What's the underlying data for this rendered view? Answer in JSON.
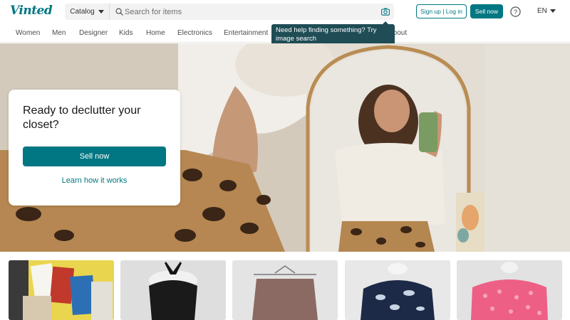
{
  "header": {
    "logo": "Vinted",
    "catalog_label": "Catalog",
    "search_placeholder": "Search for items",
    "signup_label": "Sign up | Log in",
    "sell_label": "Sell now",
    "language": "EN",
    "icons": [
      "search-icon",
      "camera-icon",
      "help-icon",
      "chevron-down-icon"
    ]
  },
  "nav": {
    "items": [
      "Women",
      "Men",
      "Designer",
      "Kids",
      "Home",
      "Electronics",
      "Entertainment",
      "About"
    ]
  },
  "tooltip": {
    "text": "Need help finding something? Try image search"
  },
  "hero": {
    "title": "Ready to declutter your closet?",
    "cta_label": "Sell now",
    "link_label": "Learn how it works"
  },
  "products": [
    {
      "name": "magazines"
    },
    {
      "name": "black-halter-top"
    },
    {
      "name": "brown-skirt"
    },
    {
      "name": "navy-floral-top"
    },
    {
      "name": "pink-sequin-top"
    }
  ],
  "colors": {
    "brand": "#007782",
    "tooltip": "#1f4c55",
    "text": "#171717"
  }
}
